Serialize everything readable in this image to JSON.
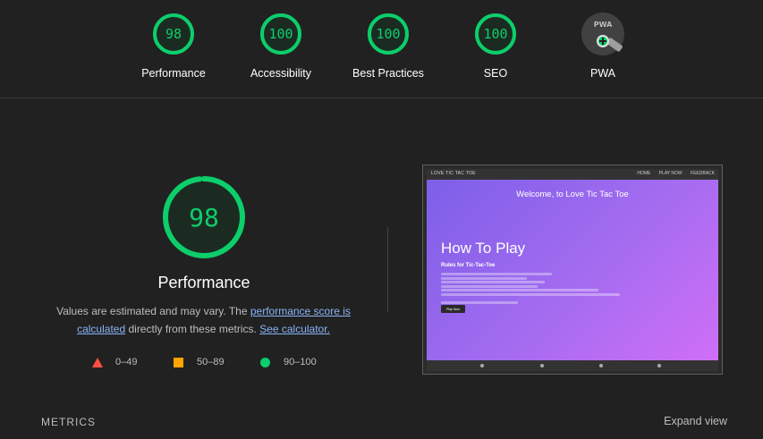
{
  "categories": [
    {
      "score": "98",
      "label": "Performance",
      "score_fraction": 0.98
    },
    {
      "score": "100",
      "label": "Accessibility",
      "score_fraction": 1.0
    },
    {
      "score": "100",
      "label": "Best Practices",
      "score_fraction": 1.0
    },
    {
      "score": "100",
      "label": "SEO",
      "score_fraction": 1.0
    }
  ],
  "pwa": {
    "badge_text": "PWA",
    "label": "PWA"
  },
  "performance": {
    "score": "98",
    "score_fraction": 0.98,
    "title": "Performance",
    "desc_part1": "Values are estimated and may vary. The ",
    "desc_link1": "performance score is calculated",
    "desc_part2": " directly from these metrics. ",
    "desc_link2": "See calculator."
  },
  "legend": {
    "fail": "0–49",
    "average": "50–89",
    "pass": "90–100"
  },
  "screenshot": {
    "nav_brand": "LOVE TIC TAC TOE",
    "nav_links": [
      "HOME",
      "PLAY NOW",
      "FEEDBACK"
    ],
    "hero_title": "Welcome, to Love Tic Tac Toe",
    "h2": "How To Play",
    "h3": "Rules for Tic-Tac-Toe",
    "button": "Play Now"
  },
  "metrics": {
    "title": "METRICS",
    "expand": "Expand view"
  },
  "colors": {
    "pass": "#0cce6b",
    "average": "#ffa400",
    "fail": "#ff4e42",
    "background": "#212121",
    "link": "#8ab4f8"
  }
}
